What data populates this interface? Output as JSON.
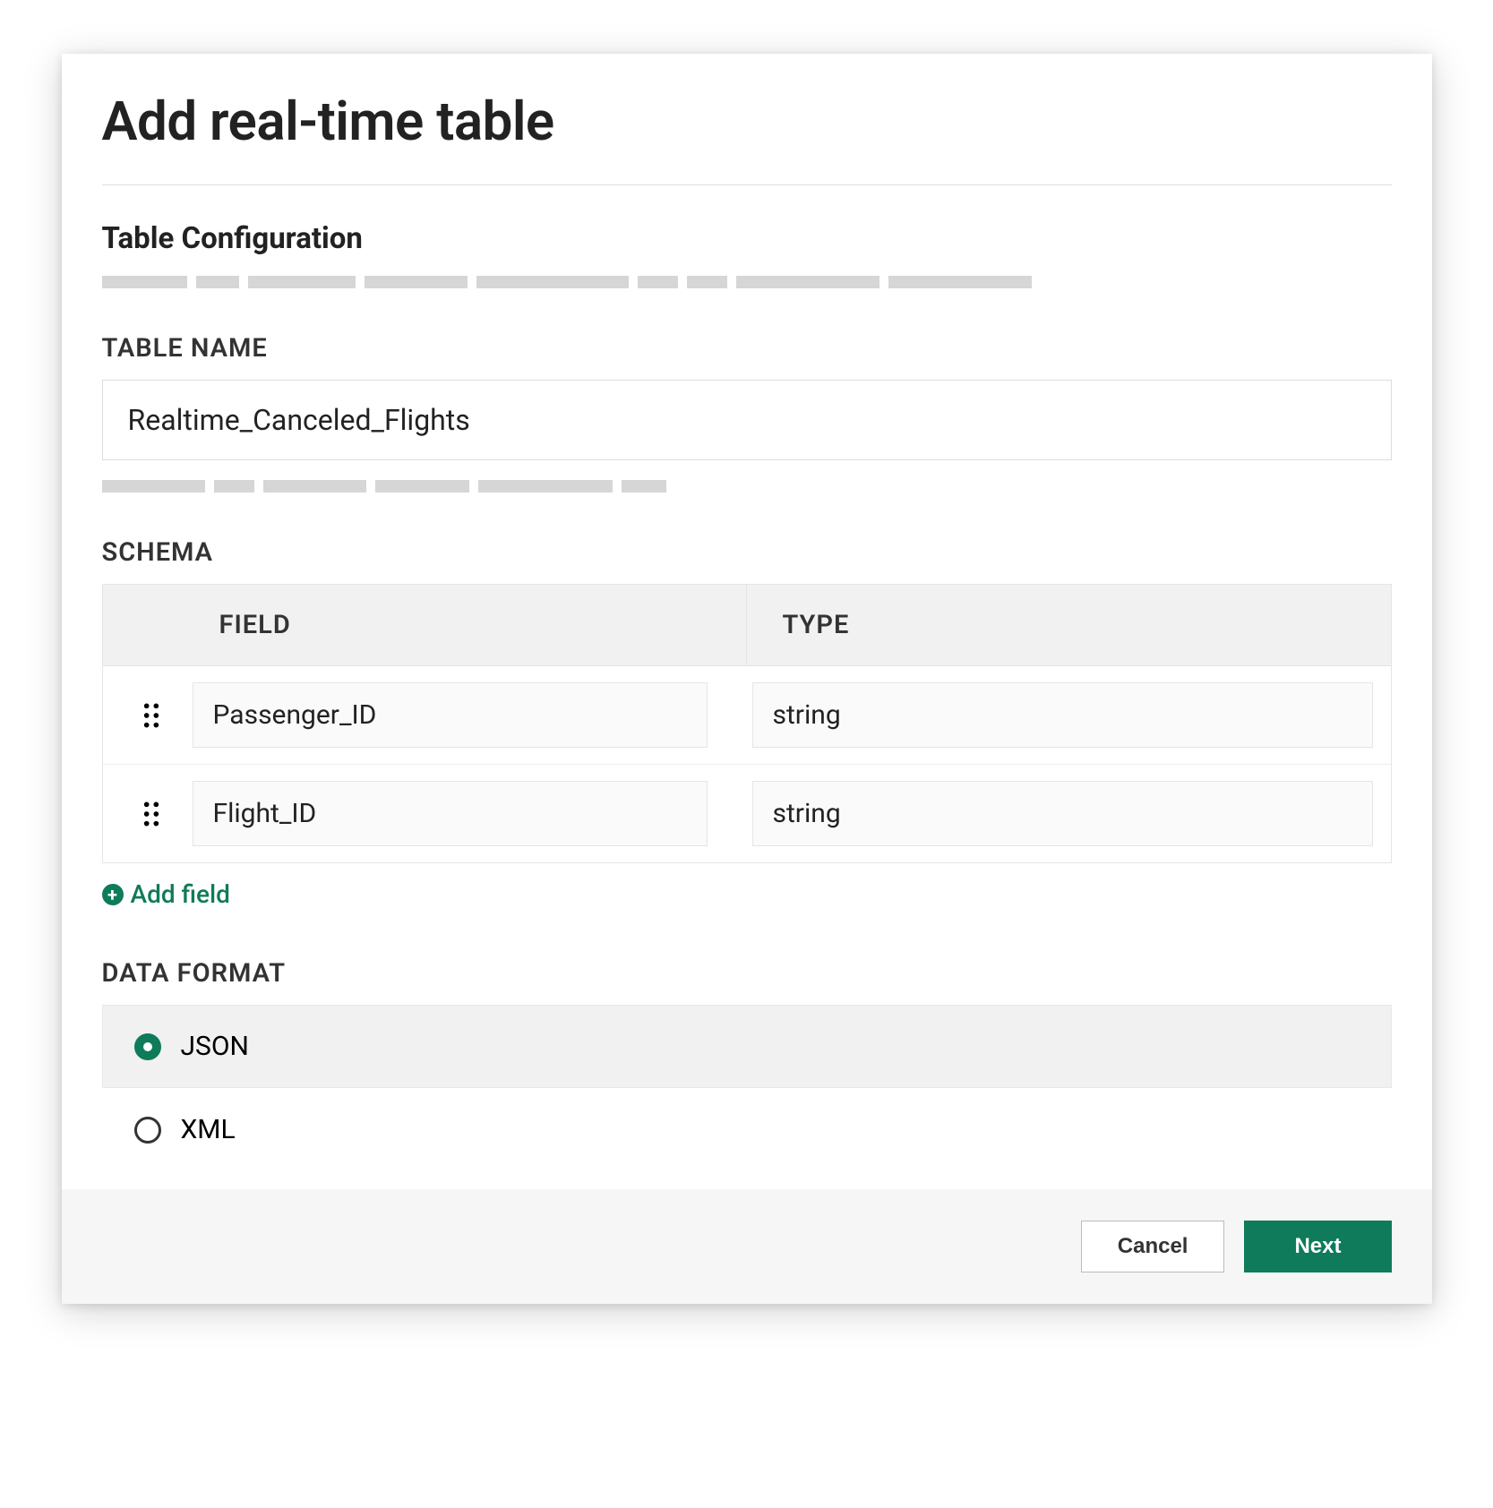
{
  "dialog": {
    "title": "Add real-time table"
  },
  "tableConfig": {
    "heading": "Table Configuration"
  },
  "tableName": {
    "label": "TABLE NAME",
    "value": "Realtime_Canceled_Flights"
  },
  "schema": {
    "label": "SCHEMA",
    "columns": {
      "field": "FIELD",
      "type": "TYPE"
    },
    "rows": [
      {
        "field": "Passenger_ID",
        "type": "string"
      },
      {
        "field": "Flight_ID",
        "type": "string"
      }
    ],
    "addFieldLabel": "Add field"
  },
  "dataFormat": {
    "label": "DATA FORMAT",
    "options": [
      {
        "label": "JSON",
        "selected": true
      },
      {
        "label": "XML",
        "selected": false
      }
    ]
  },
  "footer": {
    "cancel": "Cancel",
    "next": "Next"
  },
  "colors": {
    "accent": "#0f7b5a"
  }
}
